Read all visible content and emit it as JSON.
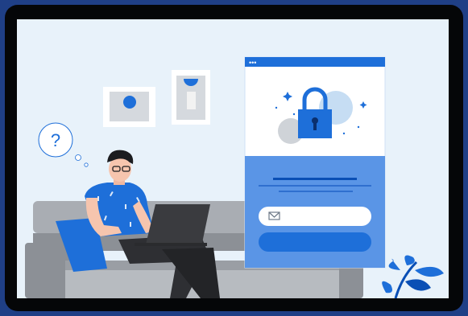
{
  "screen": {
    "background": "#e8f2fa",
    "accent": "#1e6fd9",
    "accent_dark": "#0a4fb5",
    "panel_light": "#5a95e6"
  },
  "icons": {
    "question": "question-mark-icon",
    "lock": "padlock-icon",
    "email": "envelope-icon",
    "plant": "plant-icon"
  },
  "thought_bubble": {
    "text": "?"
  },
  "login_card": {
    "dots": "•••"
  }
}
